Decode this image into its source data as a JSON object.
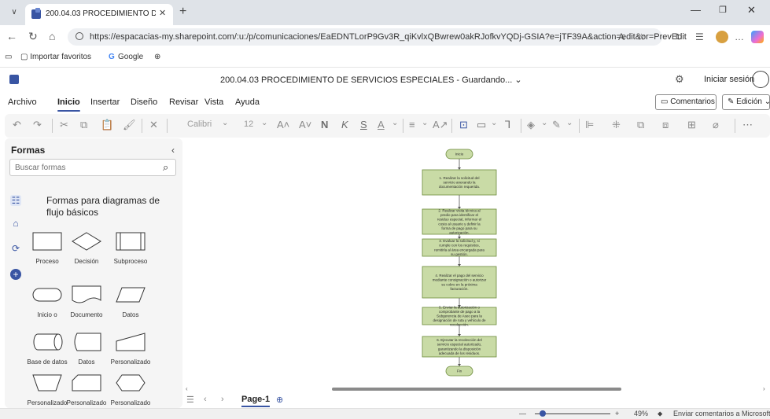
{
  "browser": {
    "tab_title": "200.04.03 PROCEDIMIENTO DE SE",
    "url": "https://espacacias-my.sharepoint.com/:u:/p/comunicaciones/EaEDNTLorP9Gv3R_qiKvlxQBwrew0akRJofkvYQDj-GSIA?e=jTF39A&action=edit&or=PrevEdit",
    "favorites": [
      "Importar favoritos",
      "Google"
    ]
  },
  "app": {
    "doc_title": "200.04.03 PROCEDIMIENTO DE SERVICIOS ESPECIALES - Guardando...",
    "signin": "Iniciar sesión"
  },
  "ribbon": {
    "tabs": [
      "Archivo",
      "Inicio",
      "Insertar",
      "Diseño",
      "Revisar",
      "Vista",
      "Ayuda"
    ],
    "comments": "Comentarios",
    "edit_mode": "Edición",
    "font": "Calibri",
    "font_size": "12",
    "bold": "N",
    "italic": "K",
    "underline": "S"
  },
  "shapes_pane": {
    "title": "Formas",
    "search_placeholder": "Buscar formas",
    "stencil_title": "Formas para diagramas de flujo básicos",
    "shapes": [
      "Proceso",
      "Decisión",
      "Subproceso",
      "Inicio o",
      "Documento",
      "Datos",
      "Base de datos",
      "Datos",
      "Personalizado",
      "Personalizado",
      "Personalizado",
      "Personalizado"
    ]
  },
  "diagram": {
    "start": "Inicio",
    "steps": [
      "1. Realizar la solicitud del servicio anexando la documentación requerida.",
      "2. Realizar visita técnica al predio para identificar el residuo especial, informar el costo al usuario y definir la forma de pago para su autorización.",
      "3. Evaluar la solicitud y, si cumple con los requisitos, remitirla al área encargada para su gestión.",
      "4. Realizar el pago del servicio mediante consignación o autorizar su cobro en la próxima facturación.",
      "5. Enviar la autorización o comprobante de pago a la Subgerencia de Aseo para la designación de ruta y vehículo de recolección.",
      "6. Ejecutar la recolección del servicio especial autorizado, garantizando la disposición adecuada de los residuos."
    ],
    "end": "Fin",
    "fill_color": "#c9dba6",
    "border_color": "#6c8b3b"
  },
  "pages": {
    "active": "Page-1"
  },
  "status": {
    "zoom": "49%",
    "feedback": "Enviar comentarios a Microsoft"
  }
}
